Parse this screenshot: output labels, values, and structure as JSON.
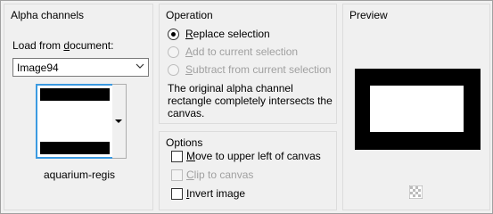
{
  "alpha_channels": {
    "title": "Alpha channels",
    "load_label_prefix": "Load from ",
    "load_label_ul": "d",
    "load_label_suffix": "ocument:",
    "document_value": "Image94",
    "channel_caption": "aquarium-regis"
  },
  "operation": {
    "title": "Operation",
    "options": [
      {
        "ul": "R",
        "rest": "eplace selection",
        "checked": true,
        "enabled": true
      },
      {
        "ul": "A",
        "rest": "dd to current selection",
        "checked": false,
        "enabled": false
      },
      {
        "ul": "S",
        "rest": "ubtract from current selection",
        "checked": false,
        "enabled": false
      }
    ],
    "description": "The original alpha channel rectangle completely intersects the canvas."
  },
  "options": {
    "title": "Options",
    "items": [
      {
        "ul": "M",
        "rest": "ove to upper left of canvas",
        "checked": false,
        "enabled": true
      },
      {
        "ul": "C",
        "rest": "lip to canvas",
        "checked": false,
        "enabled": false
      },
      {
        "ul": "I",
        "rest": "nvert image",
        "checked": false,
        "enabled": true
      }
    ]
  },
  "preview": {
    "title": "Preview",
    "icon": "transparency-checker-icon"
  }
}
